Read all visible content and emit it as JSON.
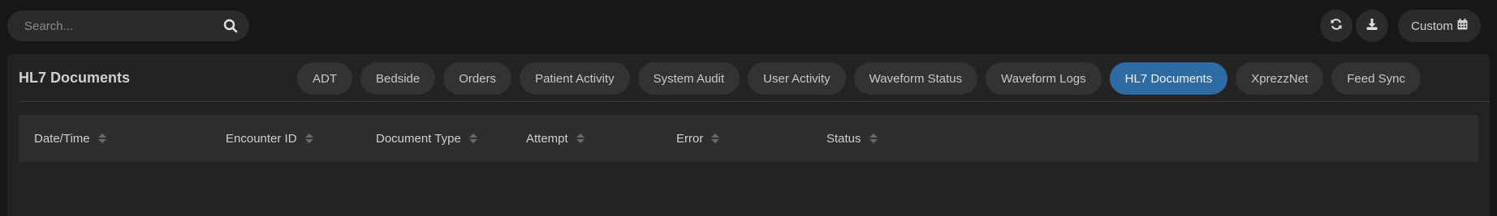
{
  "search": {
    "placeholder": "Search..."
  },
  "toolbar": {
    "refresh_icon": "refresh-icon",
    "download_icon": "download-icon",
    "custom_label": "Custom",
    "calendar_icon": "calendar-icon"
  },
  "panel": {
    "title": "HL7 Documents",
    "tabs": [
      {
        "label": "ADT",
        "active": false
      },
      {
        "label": "Bedside",
        "active": false
      },
      {
        "label": "Orders",
        "active": false
      },
      {
        "label": "Patient Activity",
        "active": false
      },
      {
        "label": "System Audit",
        "active": false
      },
      {
        "label": "User Activity",
        "active": false
      },
      {
        "label": "Waveform Status",
        "active": false
      },
      {
        "label": "Waveform Logs",
        "active": false
      },
      {
        "label": "HL7 Documents",
        "active": true
      },
      {
        "label": "XprezzNet",
        "active": false
      },
      {
        "label": "Feed Sync",
        "active": false
      }
    ]
  },
  "table": {
    "columns": [
      "Date/Time",
      "Encounter ID",
      "Document Type",
      "Attempt",
      "Error",
      "Status"
    ],
    "rows": []
  },
  "colors": {
    "active_tab": "#2d6ca2",
    "background": "#171717",
    "panel": "#232323"
  }
}
